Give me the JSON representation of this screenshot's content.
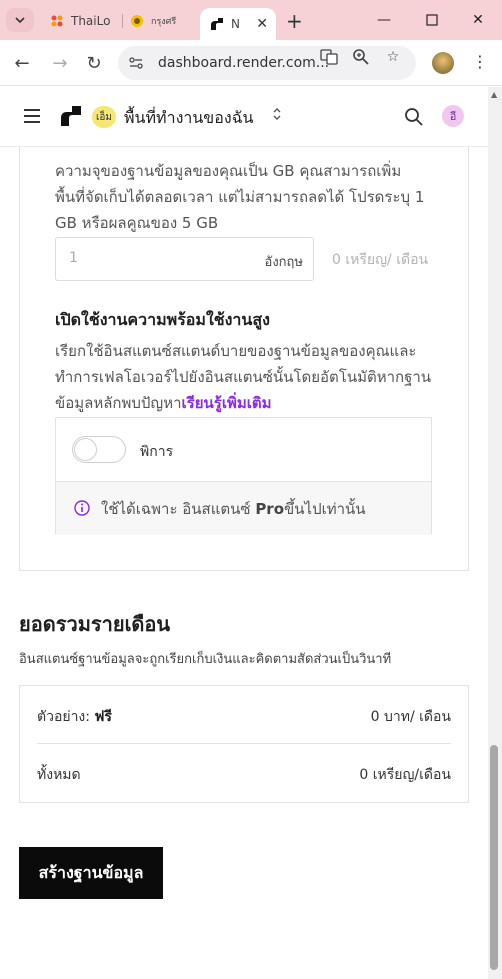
{
  "browser": {
    "tabs": [
      {
        "title": "ThaiLo"
      },
      {
        "title": "กรุงศรี"
      },
      {
        "title": "N"
      }
    ],
    "url": "dashboard.render.com..."
  },
  "header": {
    "workspace_initial": "เอ็ม",
    "workspace_name": "พื้นที่ทำงานของฉัน",
    "user_initial": "อี"
  },
  "storage": {
    "description": "ความจุของฐานข้อมูลของคุณเป็น GB คุณสามารถเพิ่มพื้นที่จัดเก็บได้ตลอดเวลา แต่ไม่สามารถลดได้ โปรดระบุ 1 GB หรือผลคูณของ 5 GB",
    "input_value": "1",
    "input_unit": "อังกฤษ",
    "cost": "0 เหรียญ/ เดือน"
  },
  "high_availability": {
    "title": "เปิดใช้งานความพร้อมใช้งานสูง",
    "description": "เรียกใช้อินสแตนซ์สแตนด์บายของฐานข้อมูลของคุณและทำการเฟลโอเวอร์ไปยังอินสแตนซ์นั้นโดยอัตโนมัติหากฐานข้อมูลหลักพบปัญหา",
    "learn_more": "เรียนรู้เพิ่มเติม",
    "toggle_label": "พิการ",
    "note_prefix": "ใช้ได้เฉพาะ อินสแตนซ์ ",
    "note_bold": "Pro",
    "note_suffix": "ขึ้นไปเท่านั้น"
  },
  "monthly": {
    "title": "ยอดรวมรายเดือน",
    "description": "อินสแตนซ์ฐานข้อมูลจะถูกเรียกเก็บเงินและคิดตามสัดส่วนเป็นวินาที",
    "rows": [
      {
        "label": "ตัวอย่าง: ",
        "label_bold": "ฟรี",
        "value": "0 บาท/ เดือน"
      },
      {
        "label": "ทั้งหมด",
        "label_bold": "",
        "value": "0 เหรียญ/เดือน"
      }
    ]
  },
  "actions": {
    "create_label": "สร้างฐานข้อมูล"
  },
  "colors": {
    "accent": "#8a2be2",
    "tabbar": "#f6d2d6",
    "primary_button": "#0b0b0b"
  }
}
